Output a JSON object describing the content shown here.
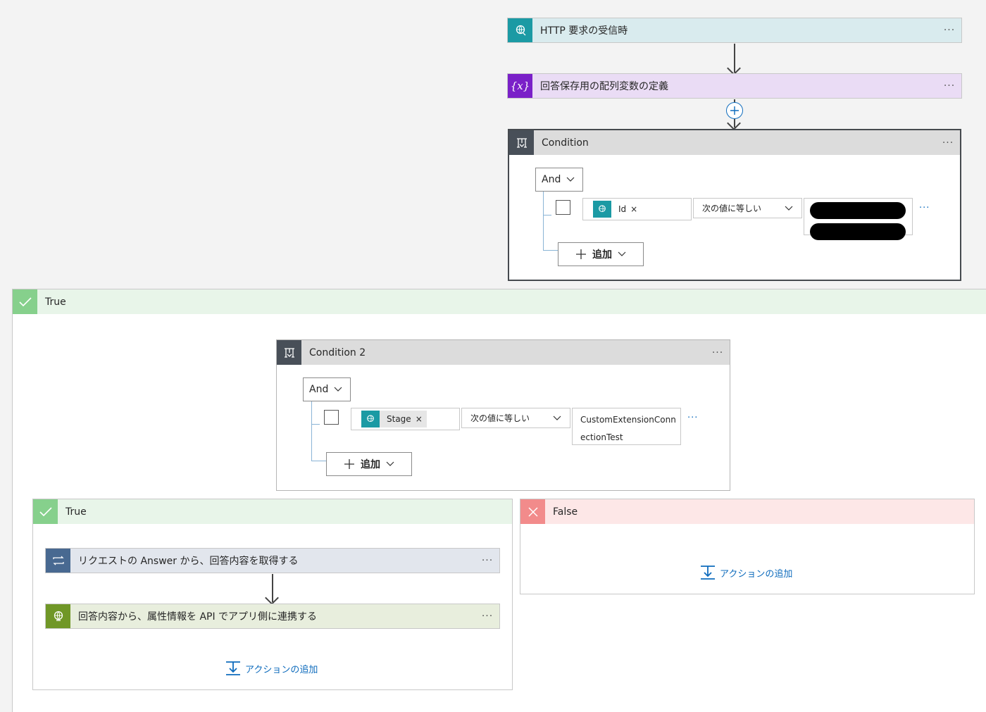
{
  "flow": {
    "trigger": {
      "title": "HTTP 要求の受信時",
      "icon": "http-globe-icon",
      "color": "#1b9aa4",
      "bg": "#d9ebee"
    },
    "var_action": {
      "title": "回答保存用の配列変数の定義",
      "icon": "variable-icon",
      "icon_text": "{x}",
      "color": "#7a20c8",
      "bg": "#eadcf5"
    },
    "more": "···"
  },
  "condition1": {
    "title": "Condition",
    "and_label": "And",
    "token_label": "Id",
    "token_x": "×",
    "operator": "次の値に等しい",
    "add_label": "追加",
    "more": "···"
  },
  "true_outer": {
    "label": "True"
  },
  "condition2": {
    "title": "Condition 2",
    "and_label": "And",
    "token_label": "Stage",
    "token_x": "×",
    "operator": "次の値に等しい",
    "value_line1": "CustomExtensionConn",
    "value_line2": "ectionTest",
    "add_label": "追加",
    "more": "···"
  },
  "true_inner": {
    "label": "True",
    "action1": {
      "title": "リクエストの Answer から、回答内容を取得する",
      "icon": "loop-icon",
      "color": "#486991",
      "bg": "#e2e6ed"
    },
    "action2": {
      "title": "回答内容から、属性情報を API でアプリ側に連携する",
      "icon": "http-globe-icon",
      "color": "#709727",
      "bg": "#e8eedd"
    },
    "add_action": "アクションの追加",
    "more": "···"
  },
  "false_branch": {
    "label": "False",
    "add_action": "アクションの追加"
  },
  "colors": {
    "true_bg": "#e8f5e9",
    "true_icon": "#86d08c",
    "false_bg": "#fde7e7",
    "false_icon": "#f28b8b",
    "accent": "#0f6cbd"
  }
}
